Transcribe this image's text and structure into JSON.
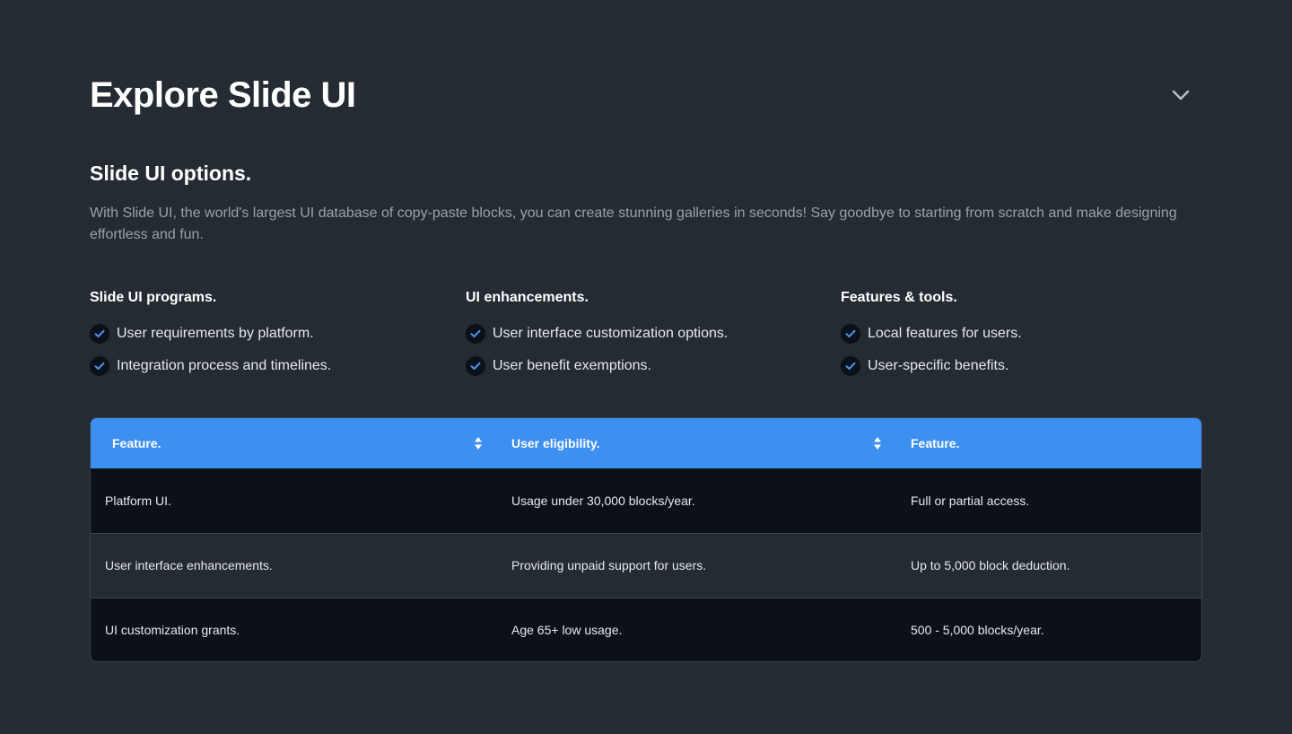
{
  "header": {
    "title": "Explore Slide UI"
  },
  "section": {
    "title": "Slide UI options.",
    "description": "With Slide UI, the world's largest UI database of copy-paste blocks, you can create stunning galleries in seconds! Say goodbye to starting from scratch and make designing effortless and fun."
  },
  "columns": [
    {
      "heading": "Slide UI programs.",
      "items": [
        "User requirements by platform.",
        "Integration process and timelines."
      ]
    },
    {
      "heading": "UI enhancements.",
      "items": [
        "User interface customization options.",
        "User benefit exemptions."
      ]
    },
    {
      "heading": "Features & tools.",
      "items": [
        "Local features for users.",
        "User-specific benefits."
      ]
    }
  ],
  "table": {
    "headers": [
      "Feature.",
      "User eligibility.",
      "Feature."
    ],
    "rows": [
      [
        "Platform UI.",
        "Usage under 30,000 blocks/year.",
        "Full or partial access."
      ],
      [
        "User interface enhancements.",
        "Providing unpaid support for users.",
        "Up to 5,000 block deduction."
      ],
      [
        "UI customization grants.",
        "Age 65+ low usage.",
        "500 - 5,000 blocks/year."
      ]
    ]
  },
  "icons": {
    "collapse": "chevron-down-icon",
    "check": "check-icon",
    "sort": "sort-icon"
  },
  "colors": {
    "background": "#252b33",
    "accent": "#3d8ff0",
    "row_dark": "#0c1119",
    "muted_text": "#9aa1aa"
  }
}
